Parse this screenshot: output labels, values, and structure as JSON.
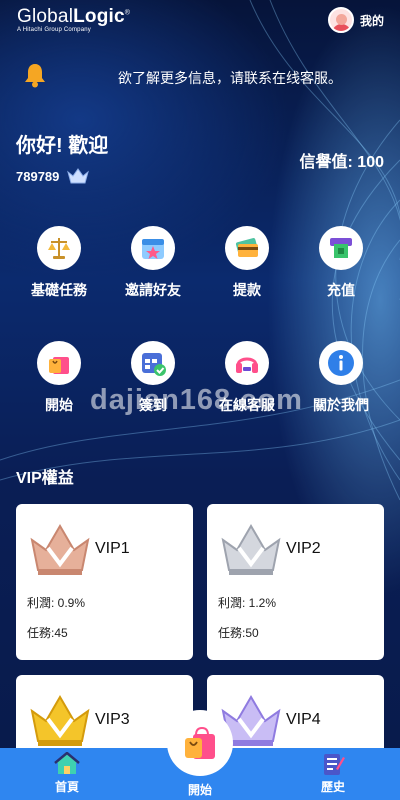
{
  "brand": {
    "name_light": "Global",
    "name_bold": "Logic",
    "tagline": "A Hitachi Group Company",
    "trademark": "®"
  },
  "user_menu": {
    "label": "我的",
    "icon": "avatar-icon"
  },
  "notice": {
    "icon": "bell-icon",
    "text": "欲了解更多信息，请联系在线客服。"
  },
  "greeting": {
    "text": "你好!  歡迎",
    "user_id": "789789",
    "credit_label": "信譽值: 100"
  },
  "menu_row1": [
    {
      "label": "基礎任務",
      "icon": "scales-icon"
    },
    {
      "label": "邀請好友",
      "icon": "calendar-star-icon"
    },
    {
      "label": "提款",
      "icon": "card-icon"
    },
    {
      "label": "充值",
      "icon": "atm-icon"
    }
  ],
  "menu_row2": [
    {
      "label": "開始",
      "icon": "shopping-bag-icon"
    },
    {
      "label": "簽到",
      "icon": "calendar-check-icon"
    },
    {
      "label": "在線客服",
      "icon": "headset-icon"
    },
    {
      "label": "關於我們",
      "icon": "info-icon"
    }
  ],
  "watermark": "dajian168.com",
  "vip_section": {
    "title": "VIP權益"
  },
  "vip_cards": [
    {
      "name": "VIP1",
      "profit": "利潤: 0.9%",
      "tasks": "任務:45",
      "color": "#e6b09a"
    },
    {
      "name": "VIP2",
      "profit": "利潤: 1.2%",
      "tasks": "任務:50",
      "color": "#c9ccd6"
    },
    {
      "name": "VIP3",
      "profit": "",
      "tasks": "",
      "color": "#f4c52a"
    },
    {
      "name": "VIP4",
      "profit": "",
      "tasks": "",
      "color": "#b9a8f0"
    }
  ],
  "tabbar": {
    "home": {
      "label": "首頁",
      "icon": "home-icon"
    },
    "start": {
      "label": "開始",
      "icon": "shopping-bag-icon"
    },
    "history": {
      "label": "歷史",
      "icon": "notepad-icon"
    }
  },
  "colors": {
    "tabbar": "#2f86f0",
    "accent_pink": "#ff5a8a",
    "bell": "#f5a623"
  }
}
